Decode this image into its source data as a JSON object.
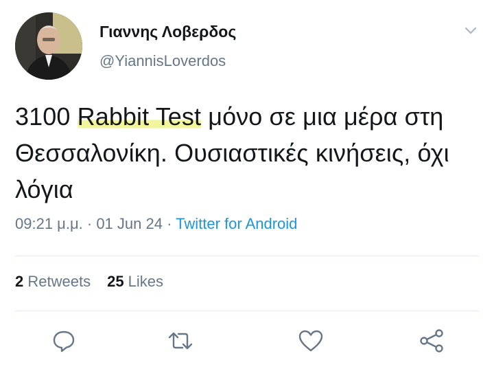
{
  "user": {
    "display_name": "Γιαννης Λοβερδος",
    "handle": "@YiannisLoverdos"
  },
  "tweet": {
    "text_part1": "3100 ",
    "text_highlight": "Rabbit Test",
    "text_part2": " μόνο σε μια μέρα στη Θεσσαλονίκη. Ουσιαστικές κινήσεις, όχι λόγια"
  },
  "meta": {
    "time": "09:21 μ.μ.",
    "sep1": " · ",
    "date": "01 Jun 24",
    "sep2": " · ",
    "source": "Twitter for Android"
  },
  "stats": {
    "retweets_count": "2",
    "retweets_label": " Retweets",
    "likes_count": "25",
    "likes_label": " Likes"
  },
  "icons": {
    "caret": "chevron-down-icon",
    "reply": "reply-icon",
    "retweet": "retweet-icon",
    "like": "heart-icon",
    "share": "share-icon"
  },
  "colors": {
    "text": "#14171a",
    "secondary": "#657786",
    "link": "#1b95e0",
    "highlight": "#eef278",
    "icon": "#657786"
  }
}
